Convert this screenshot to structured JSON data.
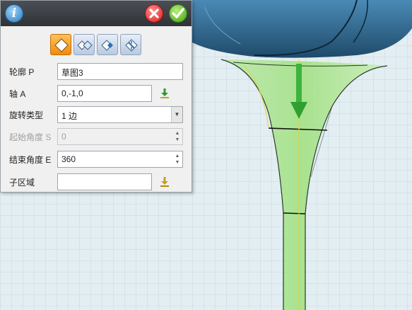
{
  "panel": {
    "info_icon_text": "i",
    "fields": {
      "profile": {
        "label": "轮廓 P",
        "value": "草图3"
      },
      "axis": {
        "label": "轴 A",
        "value": "0,-1,0"
      },
      "rotation_type": {
        "label": "旋转类型",
        "value": "1 边"
      },
      "start_angle": {
        "label": "起始角度 S",
        "value": "0"
      },
      "end_angle": {
        "label": "结束角度 E",
        "value": "360"
      },
      "sub_region": {
        "label": "子区域",
        "value": ""
      }
    },
    "mode_buttons": [
      "mode-add",
      "mode-subtract",
      "mode-intersect",
      "mode-split"
    ],
    "active_mode": "mode-add"
  },
  "colors": {
    "panel_bg": "#f0f0f0",
    "header_bg": "#3a3d42",
    "cancel": "#e02a2a",
    "confirm": "#4caf1a",
    "viewport_bg": "#e3eef2",
    "model_blue": "#2c5f84",
    "preview_green": "#9be07a",
    "arrow_green": "#3db33d"
  }
}
